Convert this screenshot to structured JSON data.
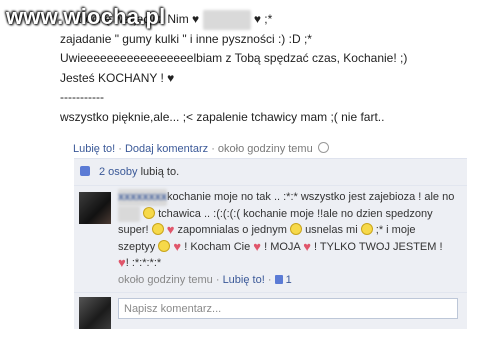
{
  "watermark": "www.wiocha.pl",
  "post": {
    "line1": "trochę warjacji z Nim ♥",
    "line1_end": "♥ ;*",
    "line2": "zajadanie \" gumy kulki \" i inne pyszności :) :D ;*",
    "line3": "Uwieeeeeeeeeeeeeeeeelbiam z Tobą spędzać czas, Kochanie! ;)",
    "line4": "Jesteś KOCHANY ! ♥",
    "line5": "-----------",
    "line6": "wszystko pięknie,ale... ;< zapalenie tchawicy mam ;( nie fart.."
  },
  "post_meta": {
    "like": "Lubię to!",
    "comment": "Dodaj komentarz",
    "time": "około godziny temu"
  },
  "likes": {
    "count_link": "2 osoby",
    "suffix": "lubią to."
  },
  "comment": {
    "line1": "kochanie moje no tak .. :*:* wszystko jest zajebioza ! ale no",
    "line2a": "tchawica .. :(:(:(:( kochanie moje !!ale no dzien spedzony",
    "line3a": "super!",
    "line3b": "zapomnialas o jednym",
    "line3c": "usnelas mi",
    "line3d": ";* i moje",
    "line4a": "szeptyy",
    "line4b": "! Kocham Cie",
    "line4c": "! MOJA",
    "line4d": "! TYLKO TWOJ JESTEM !",
    "line5": "! :*:*:*:*",
    "meta_time": "około godziny temu",
    "meta_like": "Lubię to!",
    "meta_count": "1"
  },
  "comment_input": {
    "placeholder": "Napisz komentarz..."
  },
  "colors": {
    "link": "#3b5998",
    "panel_bg": "#edeff4",
    "heart": "#e0566b"
  }
}
